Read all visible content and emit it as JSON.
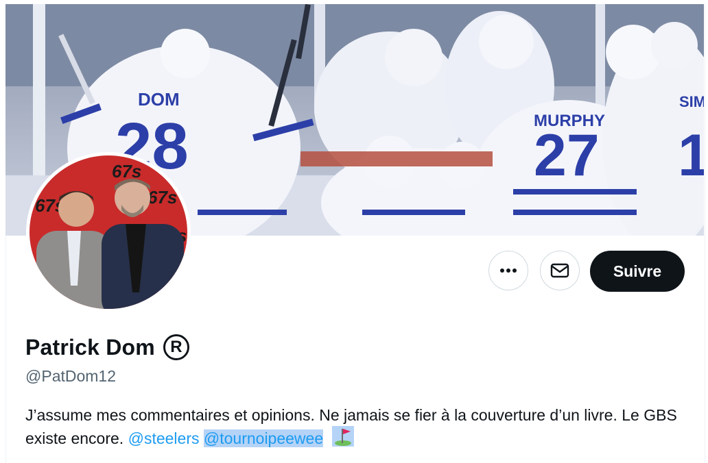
{
  "profile": {
    "display_name": "Patrick Dom",
    "badge_icon": "registered-icon",
    "badge_symbol": "R",
    "handle": "@PatDom12",
    "bio_text": "J’assume mes commentaires et opinions. Ne jamais se fier à la couverture d’un livre. Le GBS existe encore.",
    "bio_mentions": [
      "@steelers",
      "@tournoipeewee"
    ],
    "bio_emoji": "golf-flag-icon"
  },
  "banner": {
    "jersey_names": [
      "DOM",
      "MURPHY",
      "SIM"
    ],
    "jersey_numbers": [
      "28",
      "27",
      "1"
    ]
  },
  "avatar": {
    "backdrop_logo": "67s"
  },
  "actions": {
    "more_icon": "ellipsis-icon",
    "message_icon": "envelope-icon",
    "follow_label": "Suivre"
  },
  "colors": {
    "follow_bg": "#0f1419",
    "link": "#1d9bf0",
    "handle": "#536471",
    "selection": "#b4d3f7"
  }
}
